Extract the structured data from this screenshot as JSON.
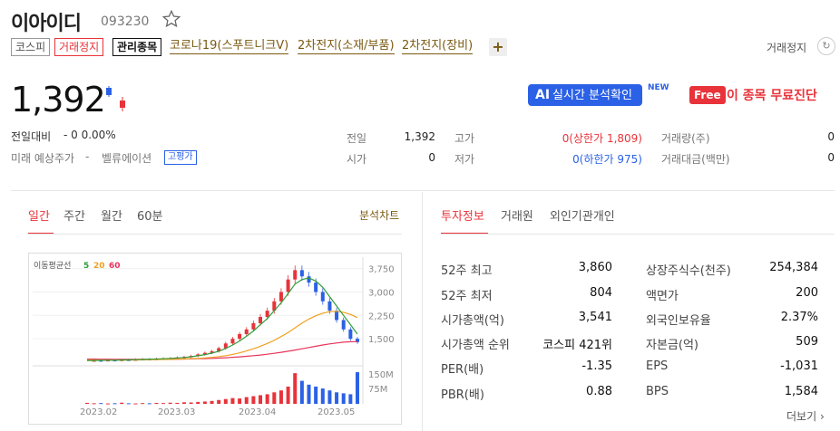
{
  "header": {
    "name": "이아이디",
    "code": "093230",
    "tags": {
      "market": "코스피",
      "halt": "거래정지",
      "managed": "관리종목"
    },
    "themes": [
      "코로나19(스푸트니크V)",
      "2차전지(소재/부품)",
      "2차전지(장비)"
    ],
    "halt_status": "거래정지"
  },
  "quote": {
    "price": "1,392",
    "change_label": "전일대비",
    "change": "- 0 0.00%",
    "forecast_label": "미래 예상주가",
    "forecast_value": "-",
    "valuation_label": "벨류에이션",
    "valuation_badge": "고평가"
  },
  "promo": {
    "ai_prefix": "AI",
    "ai_label": "실시간 분석확인",
    "new_badge": "NEW",
    "free_badge": "Free",
    "free_text": "이 종목 무료진단"
  },
  "stats": {
    "prev_label": "전일",
    "prev_value": "1,392",
    "open_label": "시가",
    "open_value": "0",
    "high_label": "고가",
    "high_value": "0(상한가 1,809)",
    "low_label": "저가",
    "low_value": "0(하한가 975)",
    "volume_label": "거래량(주)",
    "volume_value": "0",
    "amount_label": "거래대금(백만)",
    "amount_value": "0"
  },
  "chart_tabs": {
    "daily": "일간",
    "weekly": "주간",
    "monthly": "월간",
    "sixty": "60분",
    "analysis_link": "분석차트"
  },
  "info_tabs": {
    "invest": "투자정보",
    "broker": "거래원",
    "foreign": "외인기관개인"
  },
  "chart_data": {
    "type": "line",
    "legend_title": "이동평균선",
    "ma_labels": [
      "5",
      "20",
      "60"
    ],
    "x_ticks": [
      "2023.02",
      "2023.03",
      "2023.04",
      "2023.05"
    ],
    "y_ticks": [
      "3,750",
      "3,000",
      "2,250",
      "1,500"
    ],
    "volume_ticks": [
      "150M",
      "75M"
    ],
    "ylim": [
      750,
      4000
    ],
    "colors": {
      "ma5": "#2e9e3a",
      "ma20": "#f0a020",
      "ma60": "#e8335a",
      "up": "#e8333a",
      "down": "#2b61e6"
    },
    "price": [
      800,
      810,
      805,
      820,
      815,
      830,
      825,
      840,
      850,
      845,
      860,
      870,
      880,
      900,
      920,
      950,
      1000,
      1050,
      1100,
      1200,
      1350,
      1500,
      1650,
      1800,
      2000,
      2200,
      2400,
      2700,
      3000,
      3400,
      3700,
      3500,
      3300,
      3000,
      2700,
      2400,
      2100,
      1800,
      1500,
      1392
    ],
    "ma5": [
      800,
      805,
      808,
      812,
      815,
      820,
      825,
      830,
      838,
      845,
      852,
      860,
      870,
      885,
      900,
      925,
      955,
      995,
      1040,
      1100,
      1190,
      1300,
      1430,
      1580,
      1750,
      1950,
      2150,
      2400,
      2650,
      2950,
      3250,
      3400,
      3450,
      3350,
      3150,
      2850,
      2550,
      2250,
      1950,
      1650
    ],
    "ma20": [
      820,
      818,
      816,
      815,
      816,
      818,
      820,
      822,
      825,
      828,
      832,
      836,
      840,
      846,
      852,
      860,
      870,
      885,
      905,
      930,
      960,
      1000,
      1050,
      1110,
      1180,
      1260,
      1350,
      1450,
      1570,
      1700,
      1850,
      2000,
      2130,
      2240,
      2320,
      2370,
      2380,
      2350,
      2280,
      2180
    ],
    "ma60": [
      850,
      848,
      846,
      845,
      844,
      843,
      842,
      842,
      842,
      843,
      844,
      845,
      847,
      849,
      852,
      855,
      860,
      866,
      873,
      882,
      893,
      906,
      921,
      938,
      958,
      980,
      1005,
      1033,
      1065,
      1100,
      1140,
      1180,
      1220,
      1260,
      1300,
      1335,
      1365,
      1390,
      1405,
      1410
    ],
    "volume": [
      5,
      3,
      4,
      2,
      3,
      6,
      3,
      2,
      4,
      3,
      5,
      4,
      6,
      5,
      8,
      7,
      10,
      12,
      15,
      20,
      25,
      30,
      28,
      35,
      40,
      45,
      50,
      60,
      70,
      90,
      160,
      120,
      100,
      90,
      80,
      70,
      60,
      55,
      50,
      165
    ]
  },
  "investment_info": {
    "left": [
      {
        "label": "52주 최고",
        "value": "3,860"
      },
      {
        "label": "52주 최저",
        "value": "804"
      },
      {
        "label": "시가총액(억)",
        "value": "3,541"
      },
      {
        "label": "시가총액 순위",
        "value": "코스피 421위"
      },
      {
        "label": "PER(배)",
        "value": "-1.35"
      },
      {
        "label": "PBR(배)",
        "value": "0.88"
      }
    ],
    "right": [
      {
        "label": "상장주식수(천주)",
        "value": "254,384"
      },
      {
        "label": "액면가",
        "value": "200"
      },
      {
        "label": "외국인보유율",
        "value": "2.37%"
      },
      {
        "label": "자본금(억)",
        "value": "509"
      },
      {
        "label": "EPS",
        "value": "-1,031"
      },
      {
        "label": "BPS",
        "value": "1,584"
      }
    ],
    "more": "더보기"
  }
}
